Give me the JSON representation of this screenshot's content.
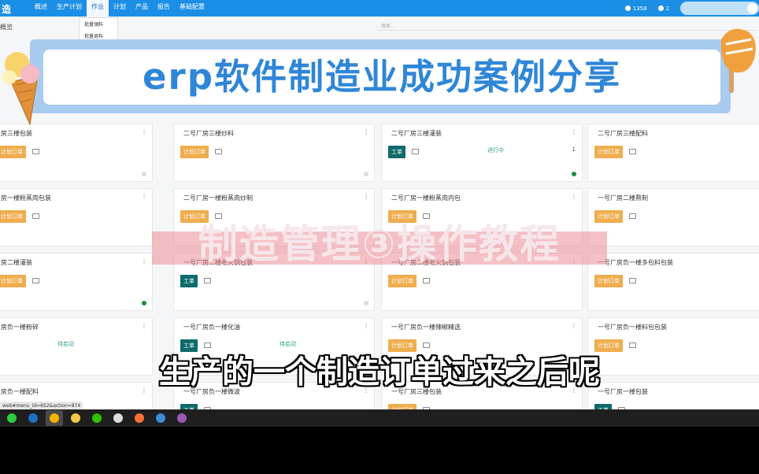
{
  "topbar": {
    "brand": "造",
    "nav": [
      "概述",
      "生产计划",
      "作业",
      "计划",
      "产品",
      "报告",
      "基础配置"
    ],
    "active_nav_index": 2,
    "badge_activity": "1358",
    "badge_messages": "2"
  },
  "submenu": [
    "批量領料",
    "批量退料"
  ],
  "breadcrumb": "概览",
  "search_placeholder": "搜索...",
  "url_hint": "web#menu_id=652&action=874",
  "banner_title": "erp软件制造业成功案例分享",
  "sub_title": "制造管理③操作教程",
  "caption": "生产的一个制造订单过来之后呢",
  "tag_labels": {
    "plan": "计划订单",
    "work": "工单"
  },
  "cards": [
    {
      "title": "房三楼包装",
      "tag": "plan",
      "status": "",
      "count": "",
      "dot": "grey"
    },
    {
      "title": "二号厂房三楼炒料",
      "tag": "plan",
      "status": "",
      "count": "",
      "dot": "grey"
    },
    {
      "title": "二号厂房三楼灌装",
      "tag": "work",
      "status": "进行中",
      "count": "1",
      "dot": "green"
    },
    {
      "title": "二号厂房三楼配料",
      "tag": "plan",
      "status": "",
      "count": "",
      "dot": ""
    },
    {
      "title": "房一楼粉蒸肉包装",
      "tag": "plan",
      "status": "",
      "count": "",
      "dot": ""
    },
    {
      "title": "二号厂房一楼粉蒸肉炒制",
      "tag": "plan",
      "status": "",
      "count": "",
      "dot": ""
    },
    {
      "title": "二号厂房一楼粉蒸肉内包",
      "tag": "plan",
      "status": "",
      "count": "",
      "dot": ""
    },
    {
      "title": "一号厂房二楼熬制",
      "tag": "plan",
      "status": "",
      "count": "",
      "dot": ""
    },
    {
      "title": "房二楼灌装",
      "tag": "plan",
      "status": "",
      "count": "",
      "dot": "green"
    },
    {
      "title": "一号厂房二楼老火锅包装",
      "tag": "work",
      "status": "",
      "count": "",
      "dot": "grey"
    },
    {
      "title": "一号厂房二楼老火锅包装",
      "tag": "plan",
      "status": "",
      "count": "",
      "dot": ""
    },
    {
      "title": "一号厂房负一楼多包料包装",
      "tag": "plan",
      "status": "",
      "count": "",
      "dot": ""
    },
    {
      "title": "房负一楼粉碎",
      "tag": "",
      "status": "待启动",
      "count": "",
      "dot": ""
    },
    {
      "title": "一号厂房负一楼化油",
      "tag": "work",
      "status": "待启动",
      "count": "",
      "dot": ""
    },
    {
      "title": "一号厂房负一楼辣椒精选",
      "tag": "plan",
      "status": "",
      "count": "",
      "dot": ""
    },
    {
      "title": "一号厂房负一楼料包包装",
      "tag": "plan",
      "status": "",
      "count": "",
      "dot": ""
    },
    {
      "title": "房负一楼配料",
      "tag": "",
      "status": "",
      "count": "",
      "dot": ""
    },
    {
      "title": "一号厂房负一楼微波",
      "tag": "work",
      "status": "",
      "count": "",
      "dot": ""
    },
    {
      "title": "一号厂房三楼包装",
      "tag": "plan",
      "status": "",
      "count": "",
      "dot": ""
    },
    {
      "title": "一号厂房一楼包装",
      "tag": "work",
      "status": "",
      "count": "",
      "dot": ""
    }
  ],
  "taskbar_icons": [
    {
      "name": "start-icon",
      "color": "#2ecc40"
    },
    {
      "name": "edge-dev-icon",
      "color": "#1f6fc5"
    },
    {
      "name": "chrome-icon",
      "color": "#f4b400"
    },
    {
      "name": "file-explorer-icon",
      "color": "#f2c94c"
    },
    {
      "name": "wechat-icon",
      "color": "#2dc100"
    },
    {
      "name": "settings-icon",
      "color": "#dddddd"
    },
    {
      "name": "firefox-icon",
      "color": "#ff7139"
    },
    {
      "name": "browser-icon",
      "color": "#3b8ed8"
    },
    {
      "name": "purple-app-icon",
      "color": "#9b59b6"
    }
  ]
}
